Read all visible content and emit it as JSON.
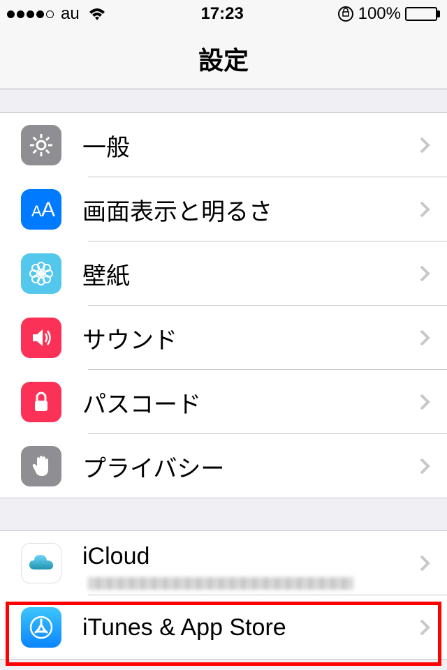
{
  "status_bar": {
    "carrier": "au",
    "time": "17:23",
    "battery_pct": "100%"
  },
  "nav": {
    "title": "設定"
  },
  "group1": {
    "items": [
      {
        "label": "一般",
        "icon": "gear-icon",
        "bg": "#8e8e93"
      },
      {
        "label": "画面表示と明るさ",
        "icon": "text-size-icon",
        "bg": "#007aff"
      },
      {
        "label": "壁紙",
        "icon": "flower-icon",
        "bg": "#54c7ec"
      },
      {
        "label": "サウンド",
        "icon": "speaker-icon",
        "bg": "#fc3158"
      },
      {
        "label": "パスコード",
        "icon": "lock-icon",
        "bg": "#fc3158"
      },
      {
        "label": "プライバシー",
        "icon": "hand-icon",
        "bg": "#8e8e93"
      }
    ]
  },
  "group2": {
    "items": [
      {
        "label": "iCloud",
        "icon": "cloud-icon"
      },
      {
        "label": "iTunes & App Store",
        "icon": "appstore-icon"
      }
    ]
  }
}
